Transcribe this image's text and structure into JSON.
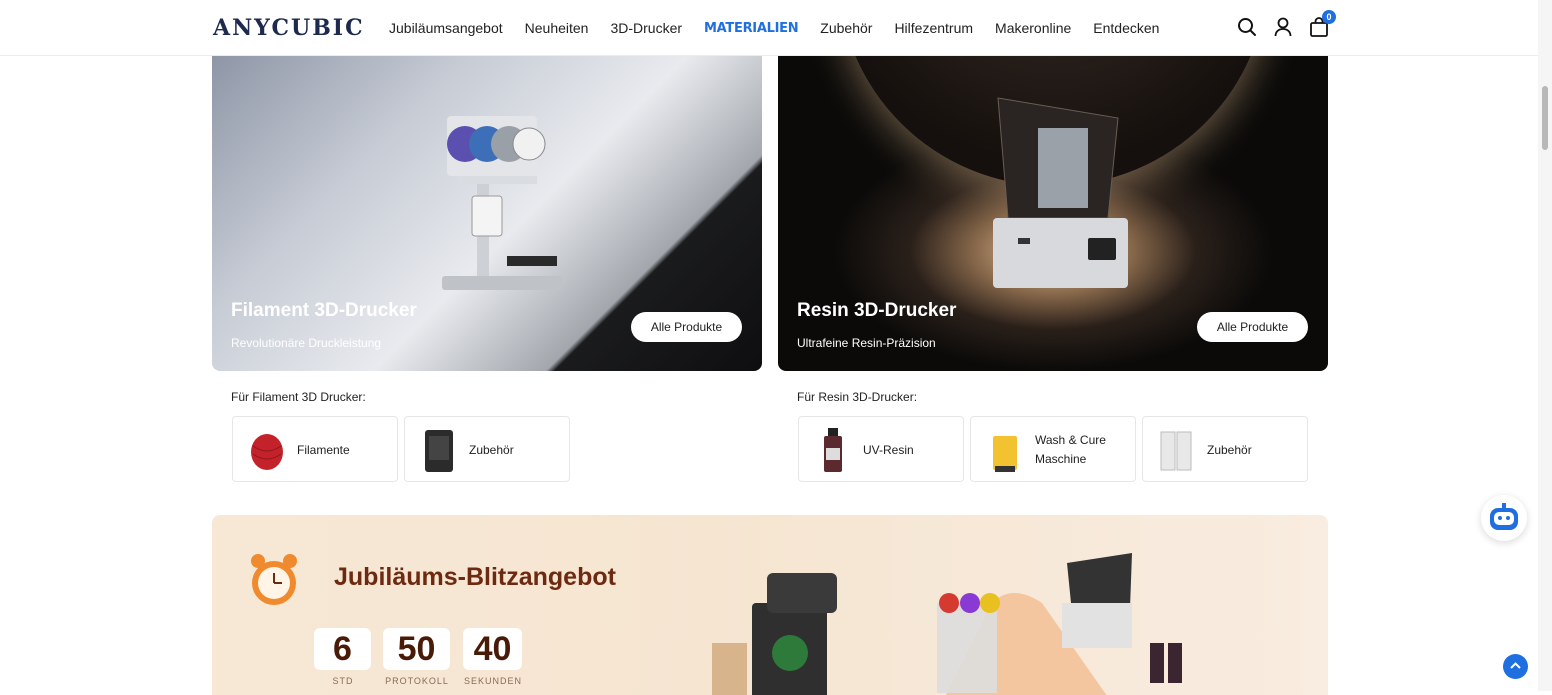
{
  "header": {
    "logo": "ANYCUBIC",
    "nav": [
      "Jubiläumsangebot",
      "Neuheiten",
      "3D-Drucker",
      "MATERIALIEN",
      "Zubehör",
      "Hilfezentrum",
      "Makeronline",
      "Entdecken"
    ],
    "cart_count": "0"
  },
  "cards": [
    {
      "title": "Filament 3D-Drucker",
      "subtitle": "Revolutionäre Druckleistung",
      "button": "Alle Produkte"
    },
    {
      "title": "Resin 3D-Drucker",
      "subtitle": "Ultrafeine Resin-Präzision",
      "button": "Alle Produkte"
    }
  ],
  "categories": {
    "filament_label": "Für Filament 3D Drucker:",
    "filament_items": [
      "Filamente",
      "Zubehör"
    ],
    "resin_label": "Für Resin 3D-Drucker:",
    "resin_items": [
      "UV-Resin",
      "Wash & Cure Maschine",
      "Zubehör"
    ]
  },
  "promo": {
    "title": "Jubiläums-Blitzangebot",
    "countdown": [
      {
        "value": "6",
        "label": "STD"
      },
      {
        "value": "50",
        "label": "PROTOKOLL"
      },
      {
        "value": "40",
        "label": "SEKUNDEN"
      }
    ]
  },
  "colors": {
    "accent": "#1f6fe0",
    "promo_title": "#6e2a10"
  },
  "icons": [
    "search-icon",
    "user-icon",
    "cart-icon",
    "chatbot-icon",
    "arrow-up-icon"
  ]
}
